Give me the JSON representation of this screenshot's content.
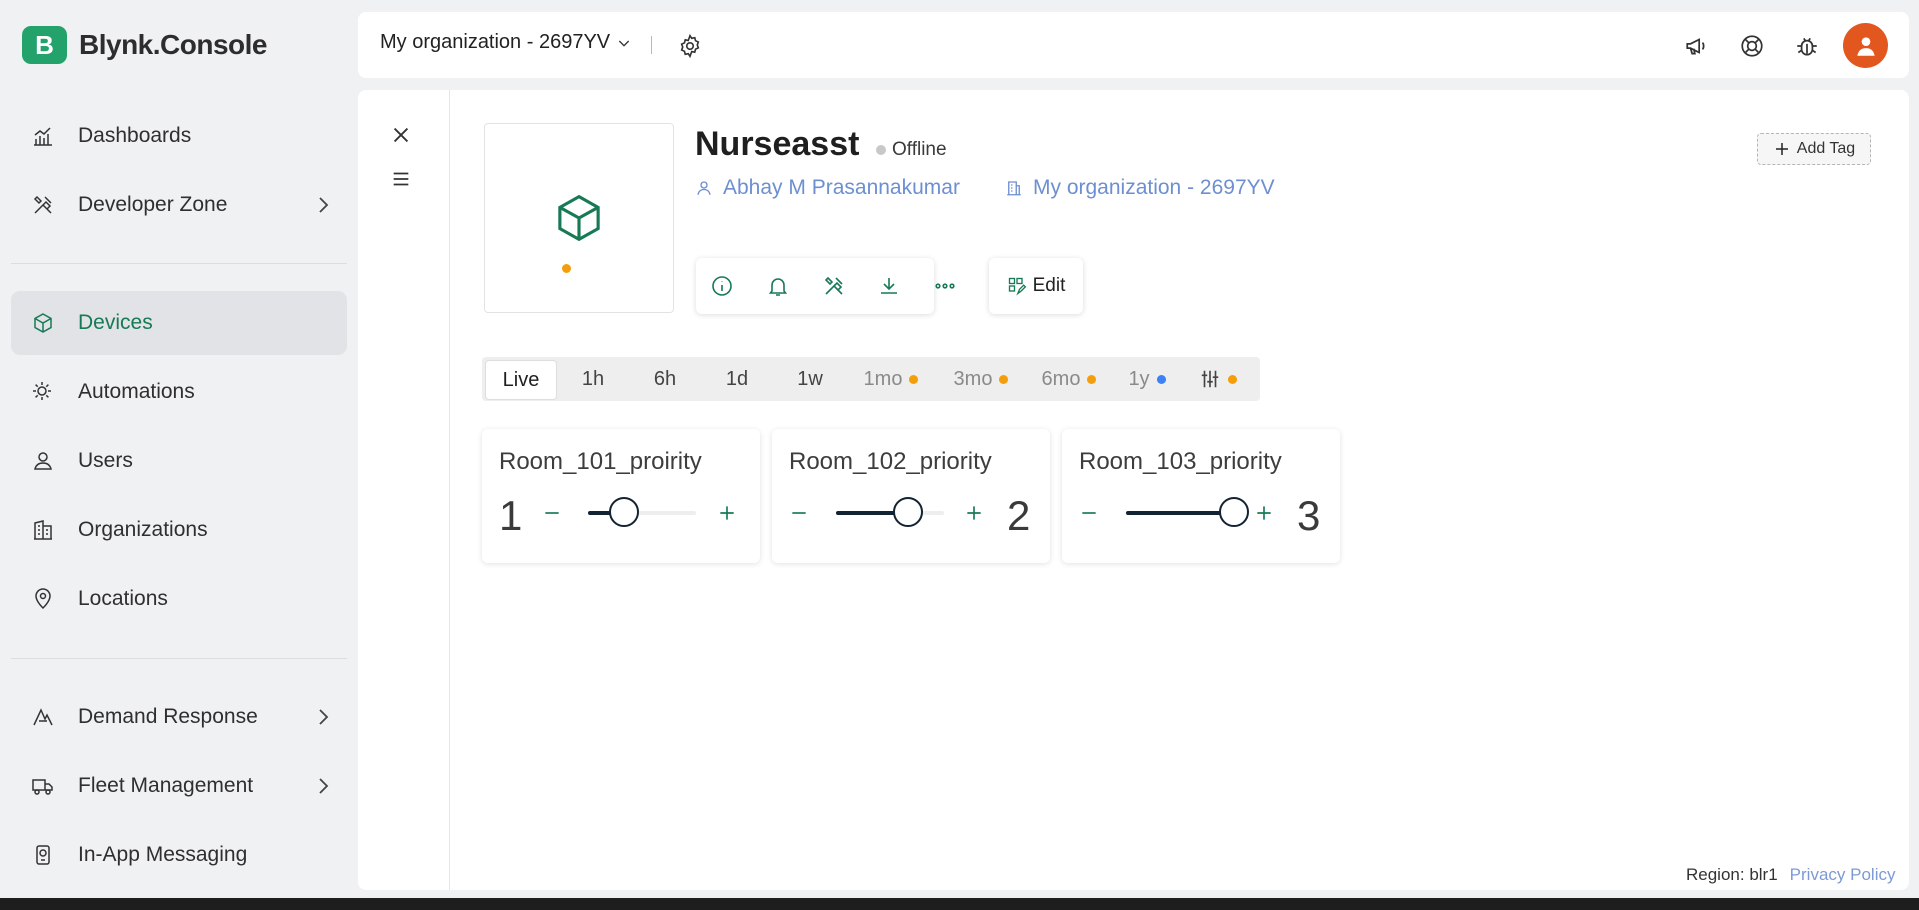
{
  "app": {
    "name": "Blynk.Console",
    "logo_letter": "B",
    "brand_color": "#23a36b"
  },
  "sidebar": {
    "items": [
      {
        "label": "Dashboards",
        "icon": "dashboards-icon",
        "has_submenu": false
      },
      {
        "label": "Developer Zone",
        "icon": "developer-zone-icon",
        "has_submenu": true
      },
      {
        "label": "Devices",
        "icon": "devices-icon",
        "has_submenu": false,
        "active": true
      },
      {
        "label": "Automations",
        "icon": "automations-icon",
        "has_submenu": false
      },
      {
        "label": "Users",
        "icon": "users-icon",
        "has_submenu": false
      },
      {
        "label": "Organizations",
        "icon": "organizations-icon",
        "has_submenu": false
      },
      {
        "label": "Locations",
        "icon": "locations-icon",
        "has_submenu": false
      },
      {
        "label": "Demand Response",
        "icon": "demand-response-icon",
        "has_submenu": true
      },
      {
        "label": "Fleet Management",
        "icon": "fleet-management-icon",
        "has_submenu": true
      },
      {
        "label": "In-App Messaging",
        "icon": "in-app-messaging-icon",
        "has_submenu": false
      }
    ]
  },
  "header": {
    "organization": "My organization - 2697YV",
    "icons": [
      "announcements-icon",
      "help-icon",
      "bug-report-icon",
      "user-avatar"
    ]
  },
  "device": {
    "name": "Nurseasst",
    "status": "Offline",
    "owner": "Abhay M Prasannakumar",
    "organization": "My organization - 2697YV",
    "add_tag_label": "Add Tag",
    "edit_label": "Edit",
    "actions": [
      "info-icon",
      "notifications-icon",
      "developer-tools-icon",
      "download-icon",
      "more-icon"
    ]
  },
  "time_range": {
    "options": [
      {
        "label": "Live",
        "active": true,
        "dot": null
      },
      {
        "label": "1h",
        "dot": null
      },
      {
        "label": "6h",
        "dot": null
      },
      {
        "label": "1d",
        "dot": null
      },
      {
        "label": "1w",
        "dot": null
      },
      {
        "label": "1mo",
        "dot": "#f59e0b"
      },
      {
        "label": "3mo",
        "dot": "#f59e0b"
      },
      {
        "label": "6mo",
        "dot": "#f59e0b"
      },
      {
        "label": "1y",
        "dot": "#3b82f6"
      }
    ],
    "custom_dot": "#f59e0b"
  },
  "widgets": [
    {
      "title": "Room_101_proirity",
      "value": "1",
      "level": 0.33
    },
    {
      "title": "Room_102_priority",
      "value": "2",
      "level": 0.67
    },
    {
      "title": "Room_103_priority",
      "value": "3",
      "level": 1.0
    }
  ],
  "footer": {
    "region": "Region: blr1",
    "privacy": "Privacy Policy"
  }
}
